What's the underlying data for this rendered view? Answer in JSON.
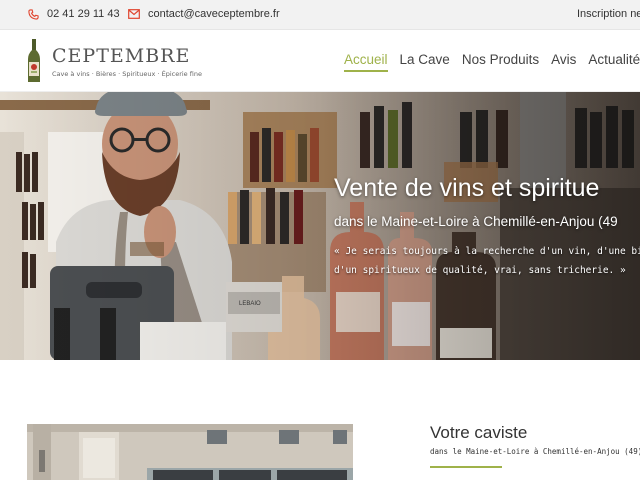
{
  "topbar": {
    "phone": "02 41 29 11 43",
    "email": "contact@caveceptembre.fr",
    "signup": "Inscription nel"
  },
  "logo": {
    "title": "CEPTEMBRE",
    "subtitle": "Cave à vins · Bières · Spiritueux · Épicerie fine"
  },
  "nav": {
    "items": [
      "Accueil",
      "La Cave",
      "Nos Produits",
      "Avis",
      "Actualités"
    ],
    "active": "Accueil"
  },
  "hero": {
    "title": "Vente de vins et spiritue",
    "subtitle": "dans le Maine-et-Loire à Chemillé-en-Anjou (49",
    "quote_line1": "« Je serais toujours à la recherche d'un vin, d'une bi",
    "quote_line2": "d'un spiritueux de qualité, vrai, sans tricherie. »",
    "label_lebaio": "LEBAIO"
  },
  "section": {
    "title": "Votre caviste",
    "subtitle": "dans le Maine-et-Loire à Chemillé-en-Anjou (49)"
  },
  "colors": {
    "accent": "#9fb24a",
    "topbar_icon": "#e0452f",
    "topbar_bg": "#f2f2f2"
  }
}
